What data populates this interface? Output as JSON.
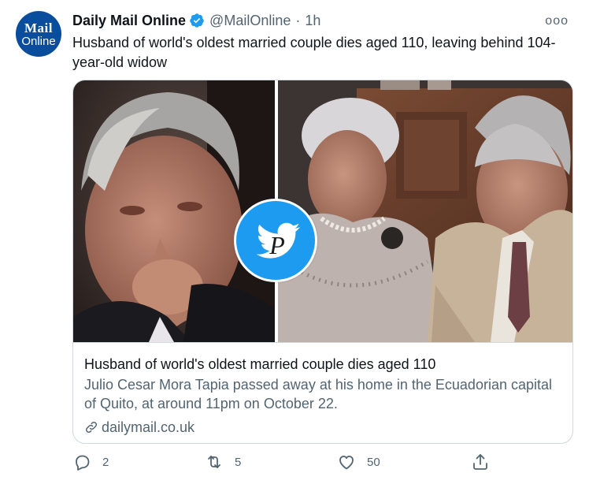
{
  "account": {
    "avatar_line1": "Mail",
    "avatar_line2": "Online",
    "name": "Daily Mail Online",
    "handle": "@MailOnline",
    "separator": "·",
    "time": "1h",
    "brand_color": "#0a4d9c",
    "verified_color": "#1d9bf0"
  },
  "more_label": "ooo",
  "tweet": {
    "text": "Husband of world's oldest married couple dies aged 110, leaving behind 104-year-old widow"
  },
  "card": {
    "title": "Husband of world's oldest married couple dies aged 110",
    "description": "Julio Cesar Mora Tapia passed away at his home in the Ecuadorian capital of Quito, at around 11pm on October 22.",
    "domain": "dailymail.co.uk",
    "domain_icon": "link-icon",
    "watermark_letter": "P",
    "watermark_icon": "twitter-bird-icon"
  },
  "actions": {
    "reply_count": "2",
    "retweet_count": "5",
    "like_count": "50",
    "icons": [
      "reply-icon",
      "retweet-icon",
      "like-icon",
      "share-icon"
    ]
  },
  "colors": {
    "text": "#0f1419",
    "secondary": "#536471",
    "border": "#cfd9de",
    "twitter_blue": "#1d9bf0"
  }
}
